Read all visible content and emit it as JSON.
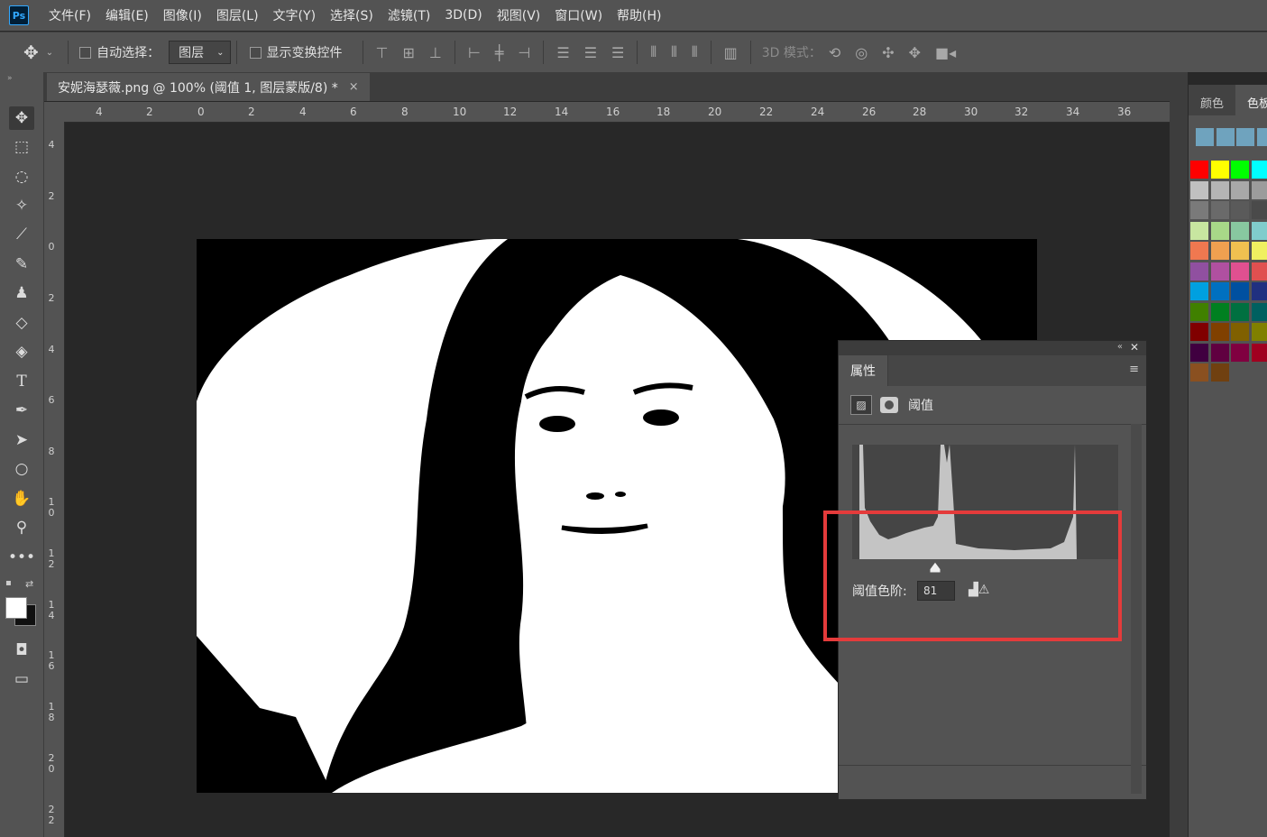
{
  "app": {
    "logo": "Ps"
  },
  "menu": [
    "文件(F)",
    "编辑(E)",
    "图像(I)",
    "图层(L)",
    "文字(Y)",
    "选择(S)",
    "滤镜(T)",
    "3D(D)",
    "视图(V)",
    "窗口(W)",
    "帮助(H)"
  ],
  "options": {
    "auto_select_label": "自动选择：",
    "layer_select_value": "图层",
    "show_transform_label": "显示变换控件",
    "mode_3d_label": "3D 模式："
  },
  "document": {
    "tab_title": "安妮海瑟薇.png @ 100% (阈值 1, 图层蒙版/8) *",
    "close_glyph": "×"
  },
  "ruler": {
    "top_ticks": [
      "4",
      "2",
      "0",
      "2",
      "4",
      "6",
      "8",
      "10",
      "12",
      "14",
      "16",
      "18",
      "20",
      "22",
      "24",
      "26",
      "28",
      "30",
      "32",
      "34",
      "36"
    ],
    "left_ticks": [
      "4",
      "2",
      "0",
      "2",
      "4",
      "6",
      "8",
      "10",
      "12",
      "14",
      "16",
      "18",
      "20",
      "22"
    ]
  },
  "swatches_panel": {
    "tabs": [
      "颜色",
      "色板"
    ],
    "recent": [
      "#6fa3be",
      "#6fa3be",
      "#6fa3be",
      "#6fa3be"
    ],
    "grid": [
      [
        "#ff0000",
        "#ffff00",
        "#00ff00",
        "#00ffff"
      ],
      [
        "#c0c0c0",
        "#b4b4b4",
        "#a8a8a8",
        "#9c9c9c"
      ],
      [
        "#7a7a7a",
        "#6a6a6a",
        "#5a5a5a",
        "#4a4a4a"
      ],
      [
        "#c8e6a0",
        "#a8d888",
        "#88c8a0",
        "#80cccc"
      ],
      [
        "#f07850",
        "#f0a050",
        "#f0c050",
        "#f0f060"
      ],
      [
        "#9050a0",
        "#b050a0",
        "#e05090",
        "#e05050"
      ],
      [
        "#00a0e0",
        "#0070c0",
        "#0050a0",
        "#203080"
      ],
      [
        "#408000",
        "#008020",
        "#007040",
        "#006060"
      ],
      [
        "#800000",
        "#804000",
        "#806000",
        "#808000"
      ],
      [
        "#400040",
        "#600040",
        "#800040",
        "#a00020"
      ],
      [
        "#8a5020",
        "#704010"
      ]
    ]
  },
  "properties_panel": {
    "tab": "属性",
    "adjustment_label": "阈值",
    "threshold_label": "阈值色阶:",
    "threshold_value": "81"
  },
  "colors": {
    "highlight": "#e43b3b"
  }
}
